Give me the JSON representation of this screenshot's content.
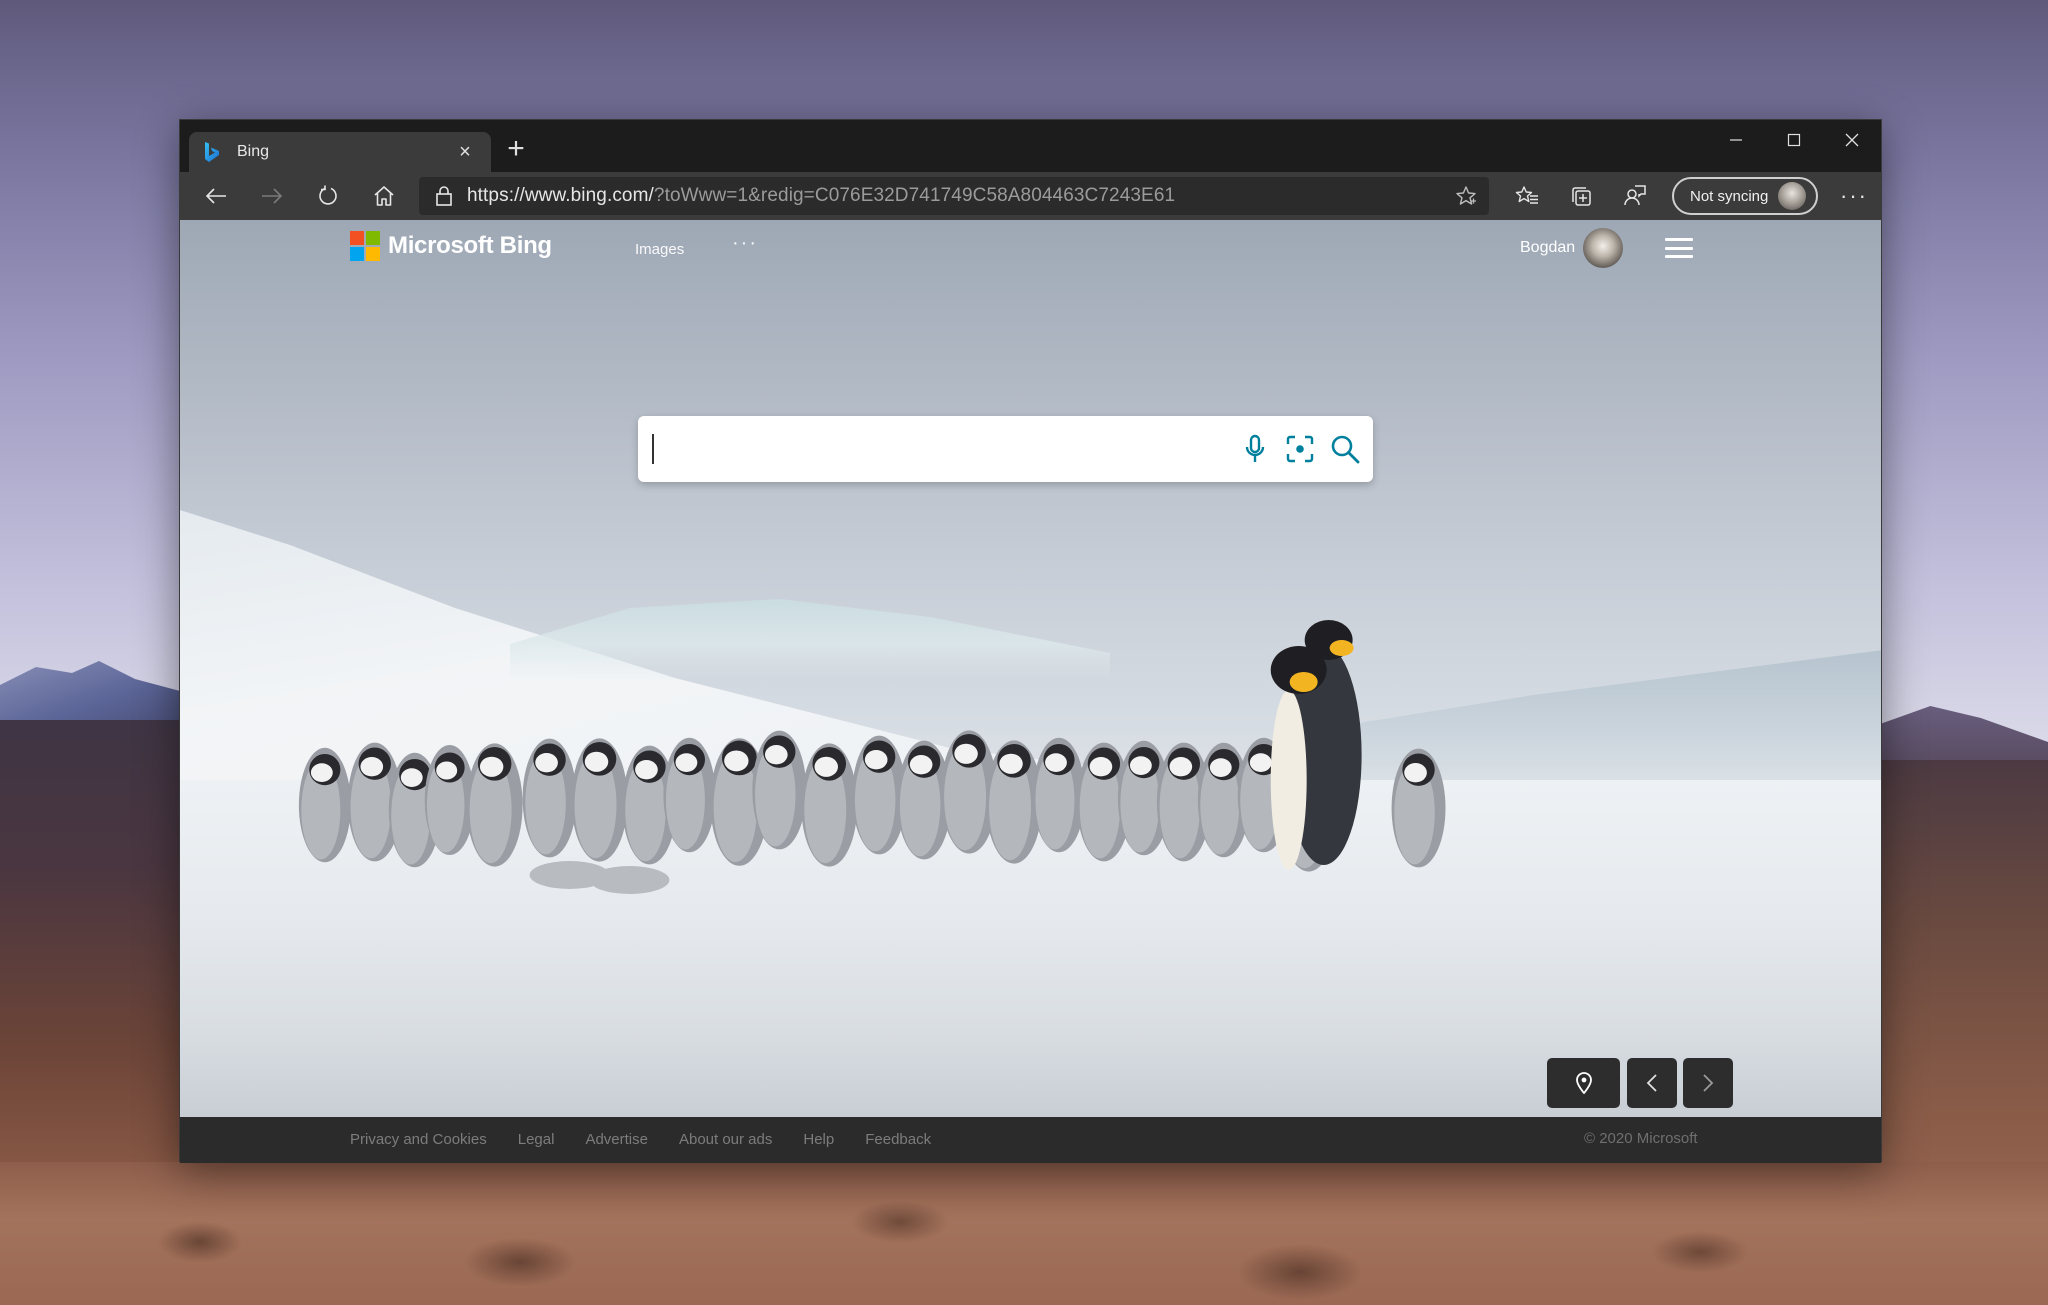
{
  "browser": {
    "tab": {
      "title": "Bing",
      "favicon": "bing-logo-icon",
      "close_label": "×"
    },
    "new_tab_label": "+",
    "window_controls": [
      "minimize-icon",
      "maximize-icon",
      "close-icon"
    ],
    "address_bar": {
      "url_host": "https://www.bing.com/",
      "url_query": "?toWww=1&redig=C076E32D741749C58A804463C7243E61",
      "lock_icon": "lock-icon",
      "favorite_icon": "add-favorite-star-icon"
    },
    "nav_icons": [
      "back-arrow-icon",
      "forward-arrow-icon",
      "refresh-icon",
      "home-icon"
    ],
    "toolbar_icons": [
      "favorites-list-icon",
      "collections-icon",
      "feedback-icon"
    ],
    "profile": {
      "label": "Not syncing"
    },
    "more_label": "···"
  },
  "bing": {
    "logo_text": "Microsoft Bing",
    "logo_colors": [
      "#f25022",
      "#7fba00",
      "#00a4ef",
      "#ffb900"
    ],
    "nav": {
      "images": "Images",
      "more": "···"
    },
    "user": {
      "name": "Bogdan"
    },
    "search": {
      "value": "",
      "placeholder": "",
      "icons": [
        "microphone-icon",
        "visual-search-icon",
        "search-icon"
      ],
      "accent_color": "#00809d"
    },
    "image_controls": [
      "location-pin-icon",
      "previous-image-icon",
      "next-image-icon"
    ],
    "footer": {
      "links": [
        "Privacy and Cookies",
        "Legal",
        "Advertise",
        "About our ads",
        "Help",
        "Feedback"
      ],
      "copyright": "© 2020 Microsoft"
    }
  }
}
